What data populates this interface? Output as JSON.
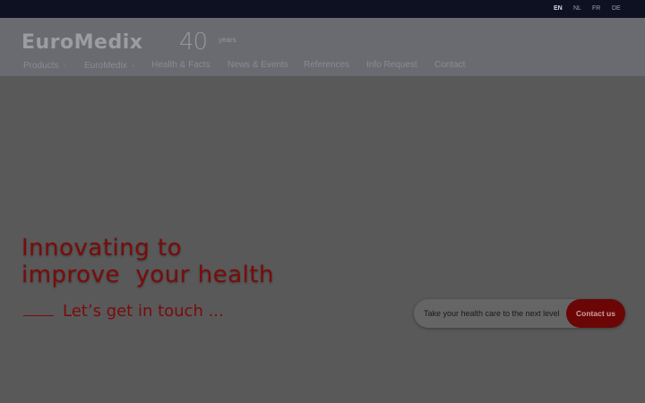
{
  "languages": [
    {
      "code": "EN",
      "active": true
    },
    {
      "code": "NL",
      "active": false
    },
    {
      "code": "FR",
      "active": false
    },
    {
      "code": "DE",
      "active": false
    }
  ],
  "logo": {
    "name": "EuroMedix",
    "anniversary": "40",
    "anniversary_suffix": "years"
  },
  "nav": {
    "items": [
      {
        "label": "Products",
        "has_dropdown": true
      },
      {
        "label": "EuroMedix",
        "has_dropdown": true
      },
      {
        "label": "Health & Facts",
        "has_dropdown": false
      },
      {
        "label": "News & Events",
        "has_dropdown": false
      },
      {
        "label": "References",
        "has_dropdown": false
      },
      {
        "label": "Info Request",
        "has_dropdown": false
      },
      {
        "label": "Contact",
        "has_dropdown": false
      }
    ]
  },
  "hero": {
    "title_line1": "Innovating to",
    "title_line2": "improve  your health",
    "cta_text": "Let’s get in touch ..."
  },
  "contact_pill": {
    "text": "Take your health care to the next level",
    "button_label": "Contact us"
  },
  "colors": {
    "accent": "#7a0b0b",
    "topbar": "#0d1122",
    "header": "#696b70",
    "background": "#595959"
  }
}
